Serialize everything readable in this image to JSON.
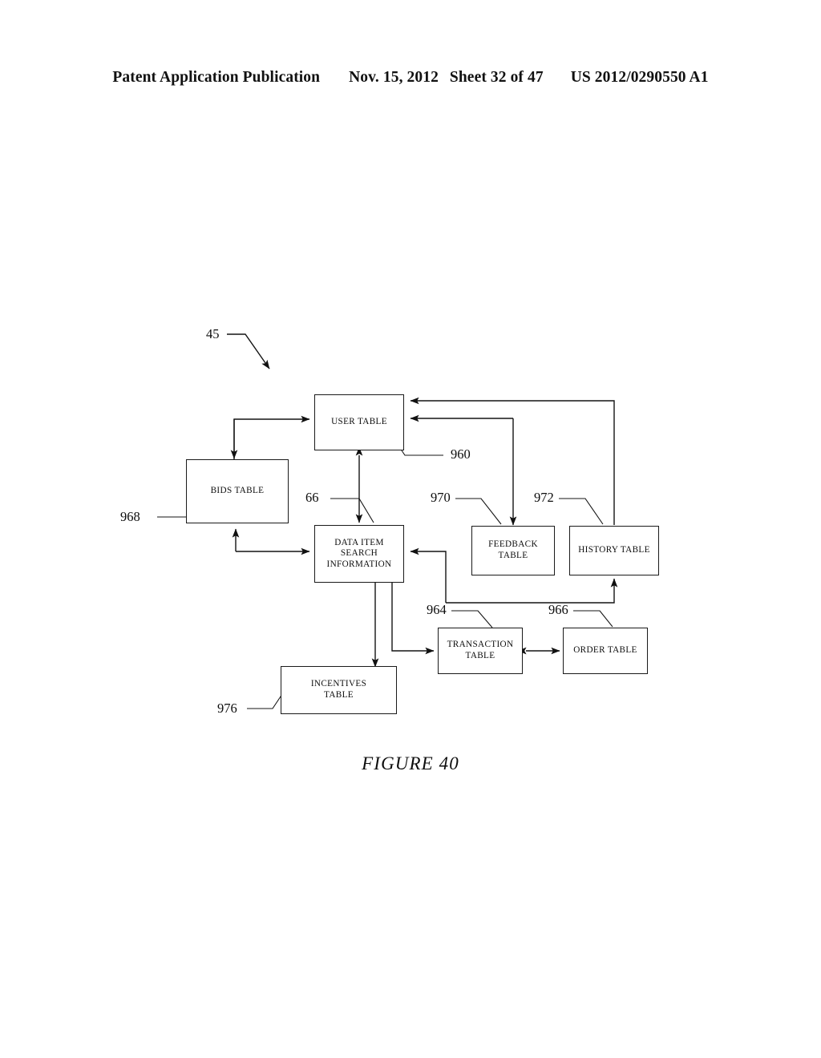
{
  "header": {
    "publication": "Patent Application Publication",
    "date": "Nov. 15, 2012",
    "sheet": "Sheet 32 of 47",
    "patent_number": "US 2012/0290550 A1"
  },
  "figure": {
    "caption": "FIGURE 40",
    "system_ref": "45",
    "nodes": [
      {
        "id": "user_table",
        "label": "USER TABLE",
        "ref": "960"
      },
      {
        "id": "bids_table",
        "label": "BIDS TABLE",
        "ref": "968"
      },
      {
        "id": "data_item",
        "label": "DATA ITEM\nSEARCH\nINFORMATION",
        "ref": "66"
      },
      {
        "id": "feedback",
        "label": "FEEDBACK\nTABLE",
        "ref": "970"
      },
      {
        "id": "history",
        "label": "HISTORY TABLE",
        "ref": "972"
      },
      {
        "id": "transaction",
        "label": "TRANSACTION\nTABLE",
        "ref": "964"
      },
      {
        "id": "order_table",
        "label": "ORDER TABLE",
        "ref": "966"
      },
      {
        "id": "incentives",
        "label": "INCENTIVES\nTABLE",
        "ref": "976"
      }
    ],
    "connections": [
      {
        "from": "bids_table",
        "to": "user_table",
        "arrow": "single"
      },
      {
        "from": "user_table",
        "to": "bids_table",
        "arrow": "single"
      },
      {
        "from": "user_table",
        "to": "data_item",
        "arrow": "double"
      },
      {
        "from": "data_item",
        "to": "bids_table",
        "arrow": "single"
      },
      {
        "from": "data_item",
        "to": "feedback",
        "arrow": "single"
      },
      {
        "from": "feedback",
        "to": "user_table",
        "arrow": "single"
      },
      {
        "from": "history",
        "to": "user_table",
        "arrow": "single"
      },
      {
        "from": "data_item",
        "to": "history",
        "arrow": "single"
      },
      {
        "from": "history",
        "to": "data_item",
        "arrow": "single"
      },
      {
        "from": "data_item",
        "to": "incentives",
        "arrow": "double"
      },
      {
        "from": "data_item",
        "to": "transaction",
        "arrow": "single"
      },
      {
        "from": "transaction",
        "to": "order_table",
        "arrow": "double"
      }
    ]
  }
}
